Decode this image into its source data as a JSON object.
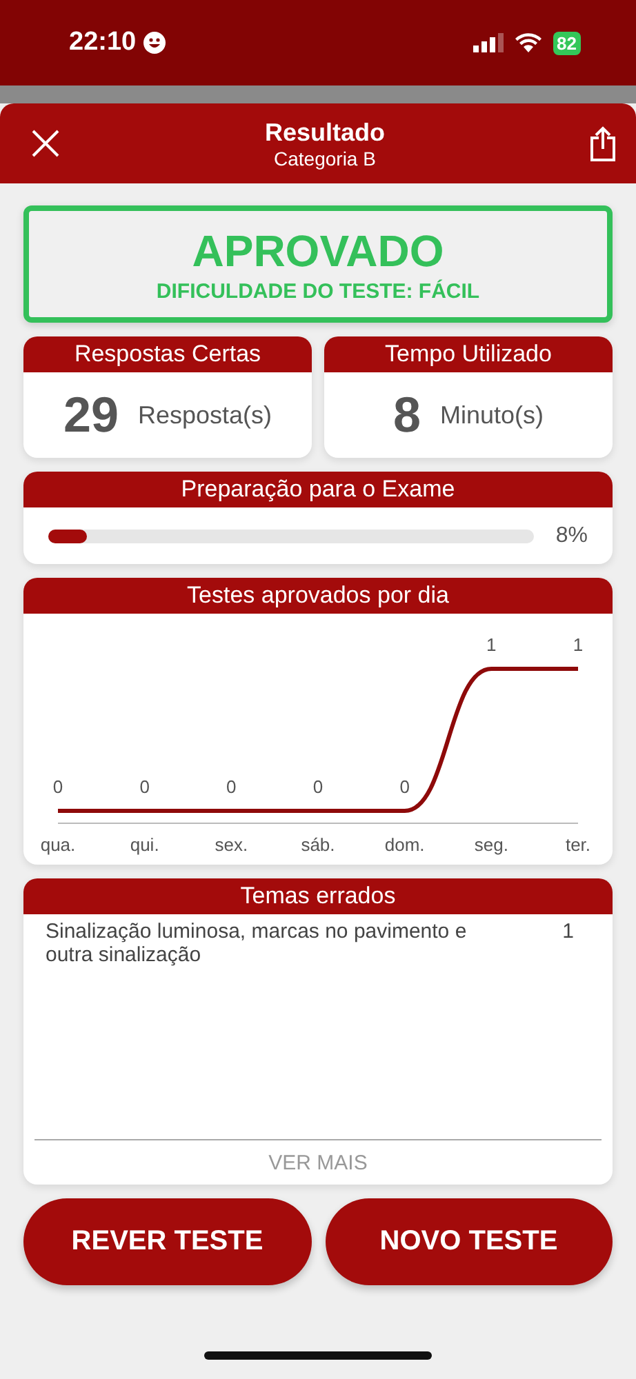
{
  "status_bar": {
    "time": "22:10",
    "battery": "82"
  },
  "header": {
    "title": "Resultado",
    "subtitle": "Categoria B"
  },
  "result": {
    "verdict": "APROVADO",
    "difficulty": "DIFICULDADE DO TESTE: FÁCIL"
  },
  "stats": [
    {
      "title": "Respostas Certas",
      "value": "29",
      "unit": "Resposta(s)"
    },
    {
      "title": "Tempo Utilizado",
      "value": "8",
      "unit": "Minuto(s)"
    }
  ],
  "progress": {
    "title": "Preparação para o Exame",
    "level": 0.08,
    "reading": "8%"
  },
  "chart": {
    "title": "Testes aprovados por dia",
    "chart_data": {
      "type": "line",
      "categories": [
        "qua.",
        "qui.",
        "sex.",
        "sáb.",
        "dom.",
        "seg.",
        "ter."
      ],
      "series": [
        {
          "color": "#8e0a0a",
          "values": [
            0,
            0,
            0,
            0,
            0,
            1,
            1
          ]
        }
      ],
      "data_labels": true
    }
  },
  "wrong_topics": {
    "title": "Temas errados",
    "items": [
      {
        "topic": "Sinalização luminosa, marcas no pavimento e outra sinalização",
        "count": "1"
      }
    ],
    "more": "VER MAIS"
  },
  "buttons": [
    "REVER TESTE",
    "NOVO TESTE"
  ]
}
